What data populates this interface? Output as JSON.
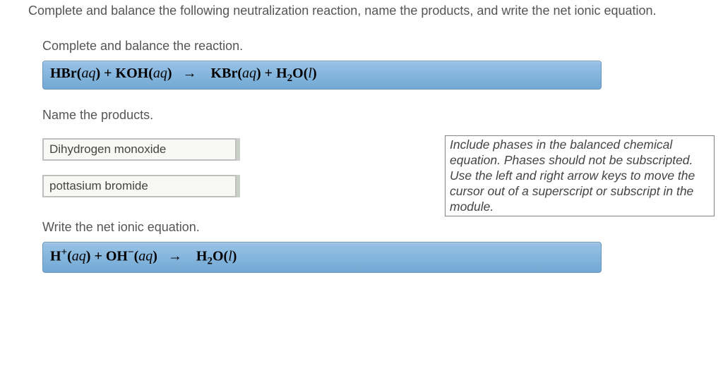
{
  "problem_statement": "Complete and balance the following neutralization reaction, name the products, and write the net ionic equation.",
  "section1": {
    "label": "Complete and balance the reaction.",
    "equation": {
      "lhs_1": "HBr",
      "lhs_1_state": "aq",
      "plus1": " + ",
      "lhs_2": "KOH",
      "lhs_2_state": "aq",
      "arrow": "→",
      "rhs_1": "KBr",
      "rhs_1_state": "aq",
      "plus2": " + ",
      "rhs_2a": "H",
      "rhs_2sub": "2",
      "rhs_2b": "O",
      "rhs_2_state": "l"
    }
  },
  "hint": "Include phases in the balanced chemical equation. Phases should not be subscripted. Use the left and right arrow keys to move the cursor out of a superscript or subscript in the module.",
  "section2": {
    "label": "Name the products.",
    "answer1": "Dihydrogen monoxide",
    "answer2": "pottasium bromide"
  },
  "section3": {
    "label": "Write the net ionic equation.",
    "equation": {
      "lhs_1": "H",
      "lhs_1_sup": "+",
      "lhs_1_state": "aq",
      "plus1": " + ",
      "lhs_2": "OH",
      "lhs_2_sup": "−",
      "lhs_2_state": "aq",
      "arrow": "→",
      "rhs_1a": "H",
      "rhs_1sub": "2",
      "rhs_1b": "O",
      "rhs_1_state": "l"
    }
  }
}
